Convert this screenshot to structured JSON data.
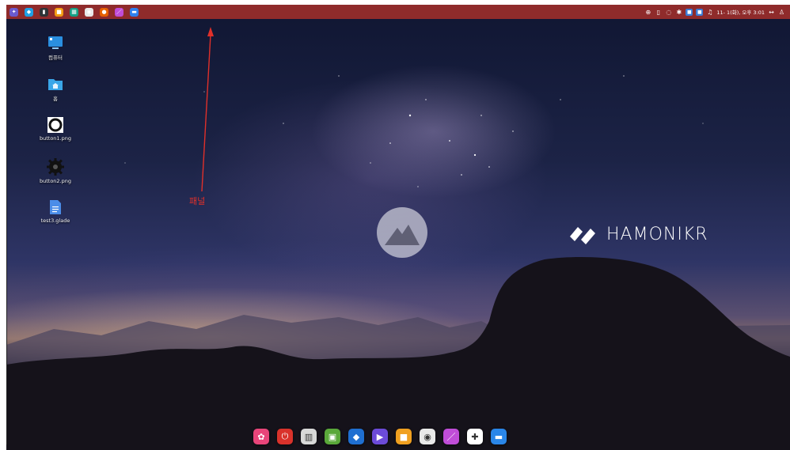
{
  "panel": {
    "app_icons": [
      {
        "name": "hamonikr-menu-icon",
        "color": "#6a5acd",
        "glyph": "✦"
      },
      {
        "name": "bird-app-icon",
        "color": "#1ea0e6",
        "glyph": "◆"
      },
      {
        "name": "terminal-icon",
        "color": "#2e3436",
        "glyph": "▮"
      },
      {
        "name": "files-icon",
        "color": "#f39c12",
        "glyph": "■"
      },
      {
        "name": "calculator-icon",
        "color": "#16a085",
        "glyph": "▦"
      },
      {
        "name": "chrome-icon",
        "color": "#e8e8e8",
        "glyph": "◉"
      },
      {
        "name": "firefox-icon",
        "color": "#e66000",
        "glyph": "●"
      },
      {
        "name": "draw-icon",
        "color": "#c04dd8",
        "glyph": "／"
      },
      {
        "name": "window-icon",
        "color": "#2f80ed",
        "glyph": "▬"
      }
    ],
    "tray": [
      "⊕",
      "▯",
      "◌",
      "✱",
      "■",
      "■",
      "♫"
    ],
    "clock": "11- 1(화), 오후 3:01",
    "tray_end": [
      "↔",
      "♙"
    ]
  },
  "desktop": {
    "icons": [
      {
        "label": "컴퓨터",
        "kind": "computer"
      },
      {
        "label": "홈",
        "kind": "home"
      },
      {
        "label": "button1.png",
        "kind": "ring"
      },
      {
        "label": "button2.png",
        "kind": "gear"
      },
      {
        "label": "test3.glade",
        "kind": "doc"
      }
    ]
  },
  "annotation": {
    "label": "패널",
    "color": "#e0302a"
  },
  "brand": {
    "name": "HAMONIKR"
  },
  "dock": {
    "items": [
      {
        "name": "app-pink-icon",
        "color": "#e8457a",
        "glyph": "✿"
      },
      {
        "name": "power-icon",
        "color": "#d9322b",
        "glyph": "⏻"
      },
      {
        "name": "trash-icon",
        "color": "#d8d8d8",
        "glyph": "▥"
      },
      {
        "name": "software-center-icon",
        "color": "#5aa83a",
        "glyph": "▣"
      },
      {
        "name": "bird-app-icon",
        "color": "#1f6fd1",
        "glyph": "◆"
      },
      {
        "name": "media-player-icon",
        "color": "#6c4bd8",
        "glyph": "▶"
      },
      {
        "name": "folder-icon",
        "color": "#f0a020",
        "glyph": "■"
      },
      {
        "name": "chrome-icon",
        "color": "#e9e9e9",
        "glyph": "◉"
      },
      {
        "name": "draw-icon",
        "color": "#c04dd8",
        "glyph": "／"
      },
      {
        "name": "slack-icon",
        "color": "#ffffff",
        "glyph": "✚"
      },
      {
        "name": "window-icon",
        "color": "#2a86e8",
        "glyph": "▬"
      }
    ]
  }
}
